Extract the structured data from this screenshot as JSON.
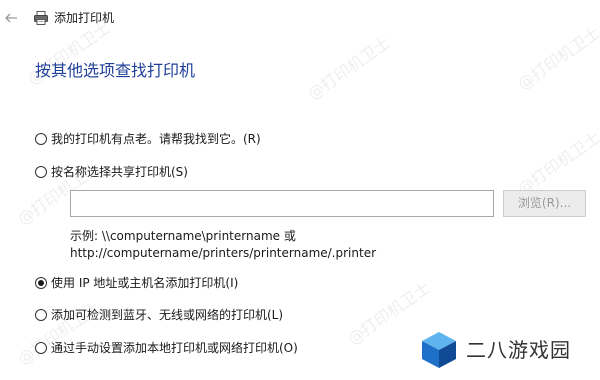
{
  "window": {
    "title": "添加打印机"
  },
  "heading": "按其他选项查找打印机",
  "options": [
    {
      "label": "我的打印机有点老。请帮我找到它。(R)",
      "selected": false
    },
    {
      "label": "按名称选择共享打印机(S)",
      "selected": false
    },
    {
      "label": "使用 IP 地址或主机名添加打印机(I)",
      "selected": true
    },
    {
      "label": "添加可检测到蓝牙、无线或网络的打印机(L)",
      "selected": false
    },
    {
      "label": "通过手动设置添加本地打印机或网络打印机(O)",
      "selected": false
    }
  ],
  "share": {
    "input_value": "",
    "browse_label": "浏览(R)...",
    "example_line1": "示例: \\\\computername\\printername 或",
    "example_line2": "http://computername/printers/printername/.printer"
  },
  "watermark": {
    "text": "@打印机卫士"
  },
  "logo": {
    "text": "二八游戏园"
  },
  "colors": {
    "heading": "#1f3f99",
    "logo_blue": "#1e6fc7"
  },
  "icons": {
    "back": "back-arrow-icon",
    "printer": "printer-icon",
    "logo": "cube-logo-icon"
  }
}
